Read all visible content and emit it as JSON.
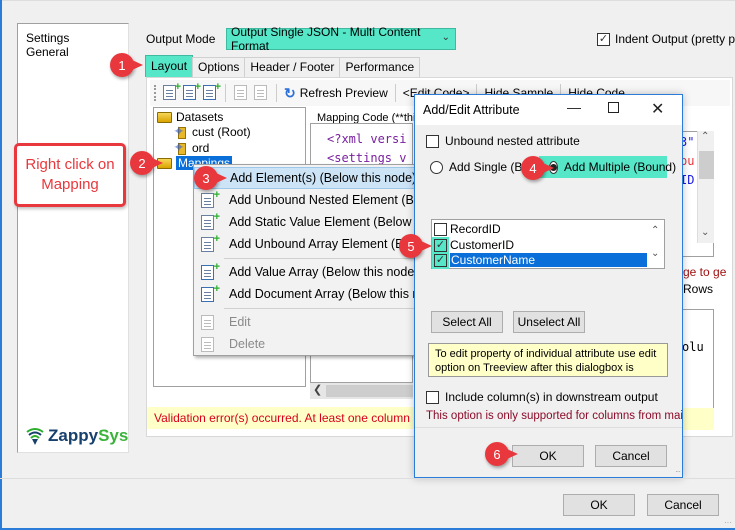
{
  "left_nav": {
    "items": [
      "Settings",
      "General"
    ],
    "logo": {
      "part1": "Zappy",
      "part2": "Sys"
    }
  },
  "output_mode": {
    "label": "Output Mode",
    "value": "Output Single JSON - Multi Content Format",
    "highlight_color": "#56e6c8"
  },
  "indent_output": {
    "label": "Indent Output (pretty p",
    "checked": true
  },
  "tabs": [
    {
      "label": "Layout",
      "active": true
    },
    {
      "label": "Options"
    },
    {
      "label": "Header / Footer"
    },
    {
      "label": "Performance"
    }
  ],
  "toolbar": {
    "refresh_label": "Refresh Preview",
    "edit_code_label": "<Edit Code>",
    "hide_sample_label": "Hide Sample",
    "hide_code_label": "Hide Code"
  },
  "tree": {
    "items": [
      {
        "label": "Datasets",
        "icon": "folder-icon"
      },
      {
        "label": "cust (Root)",
        "icon": "dataset-node-icon"
      },
      {
        "label": "ord",
        "icon": "dataset-node-icon"
      },
      {
        "label": "Mappings",
        "icon": "folder-icon",
        "selected": true
      }
    ]
  },
  "mapping_code": {
    "label": "Mapping Code (**thi",
    "lines": [
      "<?xml versi",
      "<settings v"
    ]
  },
  "right_partial": {
    "code_lines": [
      "3\"",
      "pu",
      "",
      "ID"
    ],
    "text1": "ge to ge",
    "text2": "Rows",
    "code2": "olu"
  },
  "validation_message": "Validation error(s) occurred. At least one column map",
  "context_menu": {
    "items": [
      {
        "label": "Add Element(s) (Below this node)",
        "hover": true
      },
      {
        "label": "Add Unbound Nested Element (Below this node)"
      },
      {
        "label": "Add Static Value Element (Below this node)"
      },
      {
        "label": "Add Unbound Array Element (Below this node)"
      },
      {
        "label": "Add Value Array (Below this node)"
      },
      {
        "label": "Add Document Array (Below this node)"
      },
      {
        "label": "Edit",
        "disabled": true
      },
      {
        "label": "Delete",
        "disabled": true
      }
    ]
  },
  "dialog": {
    "title": "Add/Edit Attribute",
    "unbound_nested_label": "Unbound nested attribute",
    "add_single_label": "Add Single (Bound)",
    "add_multiple_label": "Add Multiple (Bound)",
    "attributes": [
      {
        "name": "RecordID",
        "checked": false
      },
      {
        "name": "CustomerID",
        "checked": true
      },
      {
        "name": "CustomerName",
        "checked": true,
        "selected": true
      }
    ],
    "select_all_label": "Select All",
    "unselect_all_label": "Unselect All",
    "note": "To edit property of individual attribute use edit option on Treeview after this dialogbox is",
    "include_columns_label": "Include column(s) in downstream output",
    "include_note": "This option is only supported for columns from main d",
    "ok_label": "OK",
    "cancel_label": "Cancel"
  },
  "footer": {
    "ok_label": "OK",
    "cancel_label": "Cancel"
  },
  "callouts": {
    "badges": [
      "1",
      "2",
      "3",
      "4",
      "5",
      "6"
    ],
    "box_text": "Right click on Mapping",
    "color": "#e8383d"
  }
}
